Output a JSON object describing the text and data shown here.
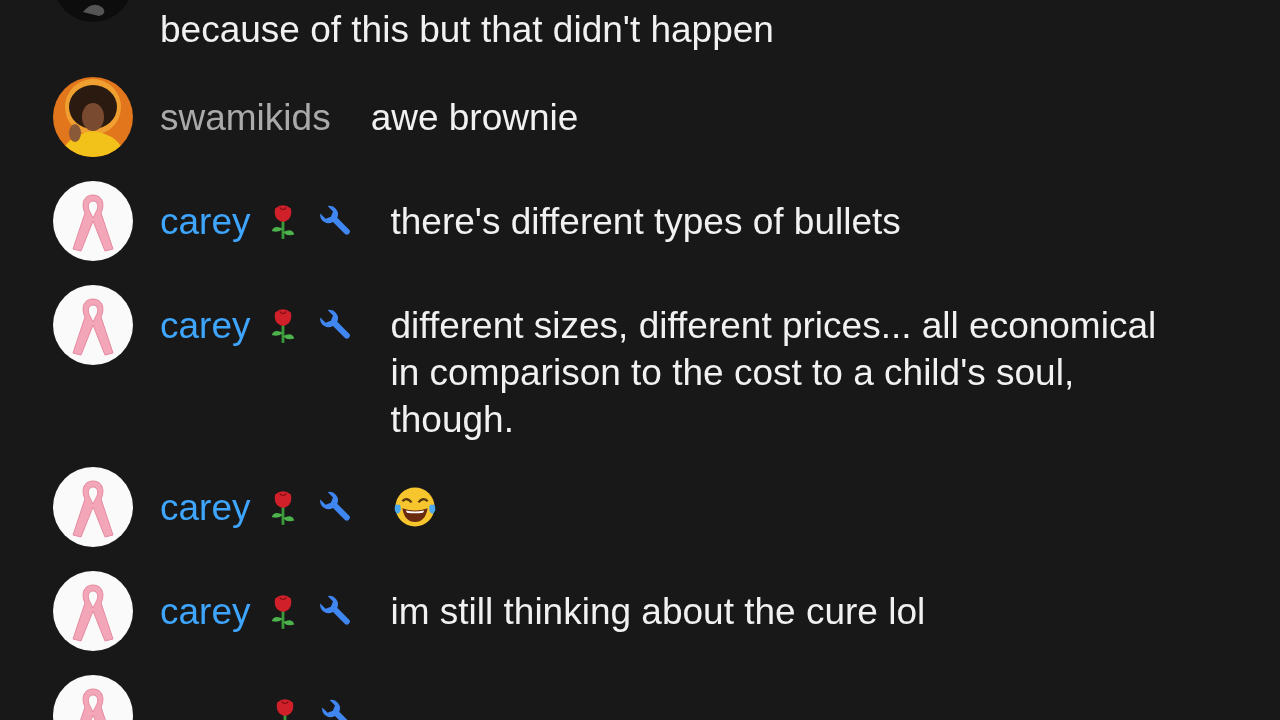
{
  "chat": {
    "messages": [
      {
        "kind": "text",
        "avatar": {
          "kind": "dark"
        },
        "text": "because of this but that didn't happen"
      },
      {
        "kind": "text",
        "author": {
          "name": "swamikids",
          "color": "#aaaaaa"
        },
        "text": "awe brownie"
      },
      {
        "kind": "text",
        "avatar": {
          "kind": "ribbon"
        },
        "author": {
          "name": "carey",
          "color": "#3ea6ff",
          "badges": [
            {
              "kind": "rose"
            },
            {
              "kind": "wrench"
            }
          ]
        },
        "text": "there's different types of bullets"
      },
      {
        "kind": "text",
        "avatar": {
          "kind": "ribbon"
        },
        "author": {
          "name": "carey",
          "color": "#3ea6ff",
          "badges": [
            {
              "kind": "rose"
            },
            {
              "kind": "wrench"
            }
          ]
        },
        "text": "different sizes, different prices... all economical in comparison to the cost to a child's soul, though."
      },
      {
        "kind": "emoji",
        "avatar": {
          "kind": "ribbon"
        },
        "author": {
          "name": "carey",
          "color": "#3ea6ff",
          "badges": [
            {
              "kind": "rose"
            },
            {
              "kind": "wrench"
            }
          ]
        }
      },
      {
        "kind": "text",
        "avatar": {
          "kind": "ribbon"
        },
        "author": {
          "name": "carey",
          "color": "#3ea6ff",
          "badges": [
            {
              "kind": "rose"
            },
            {
              "kind": "wrench"
            }
          ]
        },
        "text": "im still thinking about the cure lol"
      },
      {
        "kind": "cut",
        "avatar": {
          "kind": "ribbon"
        },
        "author": {
          "badges": [
            {
              "kind": "rose"
            },
            {
              "kind": "wrench"
            }
          ]
        }
      }
    ]
  }
}
